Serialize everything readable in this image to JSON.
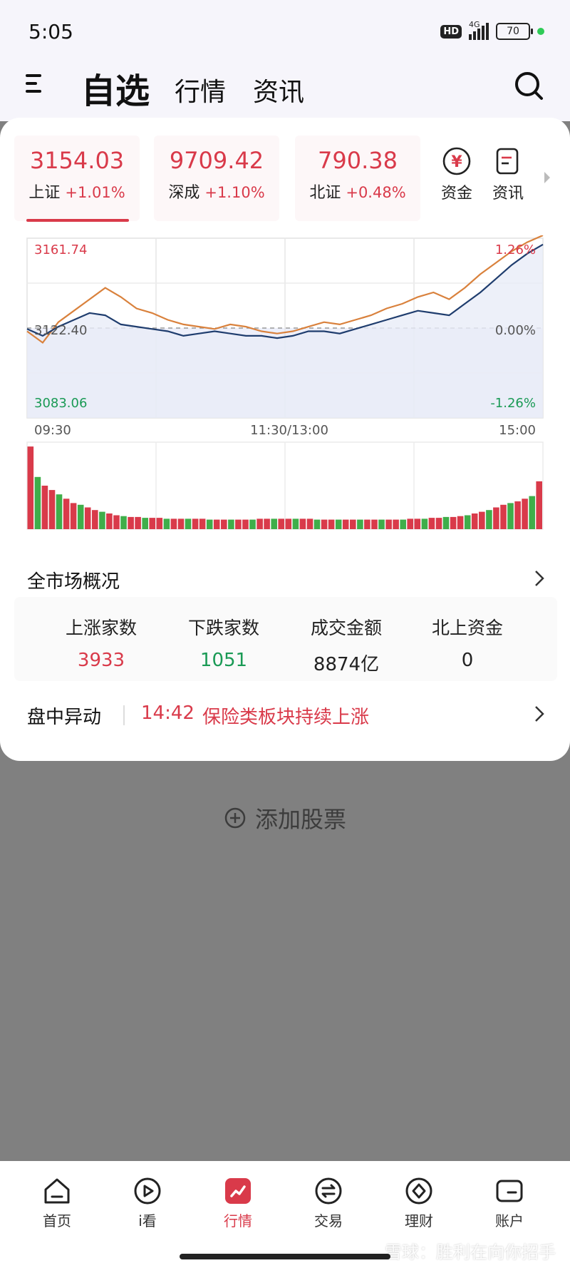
{
  "status_bar": {
    "time": "5:05",
    "hd": "HD",
    "network": "4G",
    "battery": "70"
  },
  "header": {
    "tabs": [
      "自选",
      "行情",
      "资讯"
    ]
  },
  "indices": [
    {
      "value": "3154.03",
      "name": "上证",
      "change": "+1.01%"
    },
    {
      "value": "9709.42",
      "name": "深成",
      "change": "+1.10%"
    },
    {
      "value": "790.38",
      "name": "北证",
      "change": "+0.48%"
    }
  ],
  "quick_links": [
    {
      "label": "资金",
      "icon": "yuan-circle-icon",
      "glyph": "¥"
    },
    {
      "label": "资讯",
      "icon": "news-doc-icon"
    }
  ],
  "chart_data": {
    "type": "line",
    "x_ticks": [
      "09:30",
      "11:30/13:00",
      "15:00"
    ],
    "y_left_labels": [
      "3161.74",
      "3122.40",
      "3083.06"
    ],
    "y_right_labels": [
      "1.26%",
      "0.00%",
      "-1.26%"
    ],
    "ylim": [
      3083.06,
      3161.74
    ],
    "baseline": 3122.4,
    "grid": true,
    "series": [
      {
        "color": "#d9813c",
        "values": [
          3121,
          3116,
          3125,
          3130,
          3135,
          3140,
          3136,
          3131,
          3129,
          3126,
          3124,
          3123,
          3122,
          3124,
          3123,
          3121,
          3120,
          3121,
          3123,
          3125,
          3124,
          3126,
          3128,
          3131,
          3133,
          3136,
          3138,
          3135,
          3140,
          3146,
          3151,
          3156,
          3160,
          3163
        ]
      },
      {
        "color": "#1f3d6e",
        "values": [
          3122,
          3119,
          3123,
          3126,
          3129,
          3128,
          3124,
          3123,
          3122,
          3121,
          3119,
          3120,
          3121,
          3120,
          3119,
          3119,
          3118,
          3119,
          3121,
          3121,
          3120,
          3122,
          3124,
          3126,
          3128,
          3130,
          3129,
          3128,
          3133,
          3138,
          3144,
          3150,
          3155,
          3159
        ]
      }
    ],
    "volume": [
      0.95,
      0.6,
      0.5,
      0.45,
      0.4,
      0.35,
      0.3,
      0.28,
      0.25,
      0.22,
      0.2,
      0.18,
      0.16,
      0.15,
      0.14,
      0.14,
      0.13,
      0.13,
      0.13,
      0.12,
      0.12,
      0.12,
      0.12,
      0.12,
      0.12,
      0.11,
      0.11,
      0.11,
      0.11,
      0.11,
      0.11,
      0.11,
      0.12,
      0.12,
      0.12,
      0.12,
      0.12,
      0.12,
      0.12,
      0.12,
      0.11,
      0.11,
      0.11,
      0.11,
      0.11,
      0.11,
      0.11,
      0.11,
      0.11,
      0.11,
      0.11,
      0.11,
      0.11,
      0.12,
      0.12,
      0.12,
      0.13,
      0.13,
      0.14,
      0.14,
      0.15,
      0.16,
      0.18,
      0.2,
      0.22,
      0.25,
      0.28,
      0.3,
      0.32,
      0.35,
      0.38,
      0.55
    ]
  },
  "market_overview": {
    "title": "全市场概况",
    "stats": [
      {
        "label": "上涨家数",
        "value": "3933",
        "color": "#d93a4a"
      },
      {
        "label": "下跌家数",
        "value": "1051",
        "color": "#1a9a55"
      },
      {
        "label": "成交金额",
        "value": "8874亿",
        "color": "#222222"
      },
      {
        "label": "北上资金",
        "value": "0",
        "color": "#222222"
      }
    ]
  },
  "intraday_alert": {
    "label": "盘中异动",
    "time": "14:42",
    "text": "保险类板块持续上涨"
  },
  "add_stock": {
    "label": "添加股票"
  },
  "tabbar": [
    {
      "label": "首页",
      "icon": "home-icon"
    },
    {
      "label": "i看",
      "icon": "play-icon"
    },
    {
      "label": "行情",
      "icon": "market-icon",
      "active": true
    },
    {
      "label": "交易",
      "icon": "exchange-icon"
    },
    {
      "label": "理财",
      "icon": "wealth-icon"
    },
    {
      "label": "账户",
      "icon": "account-icon"
    }
  ],
  "watermark": "雪球：胜利在向你招手"
}
